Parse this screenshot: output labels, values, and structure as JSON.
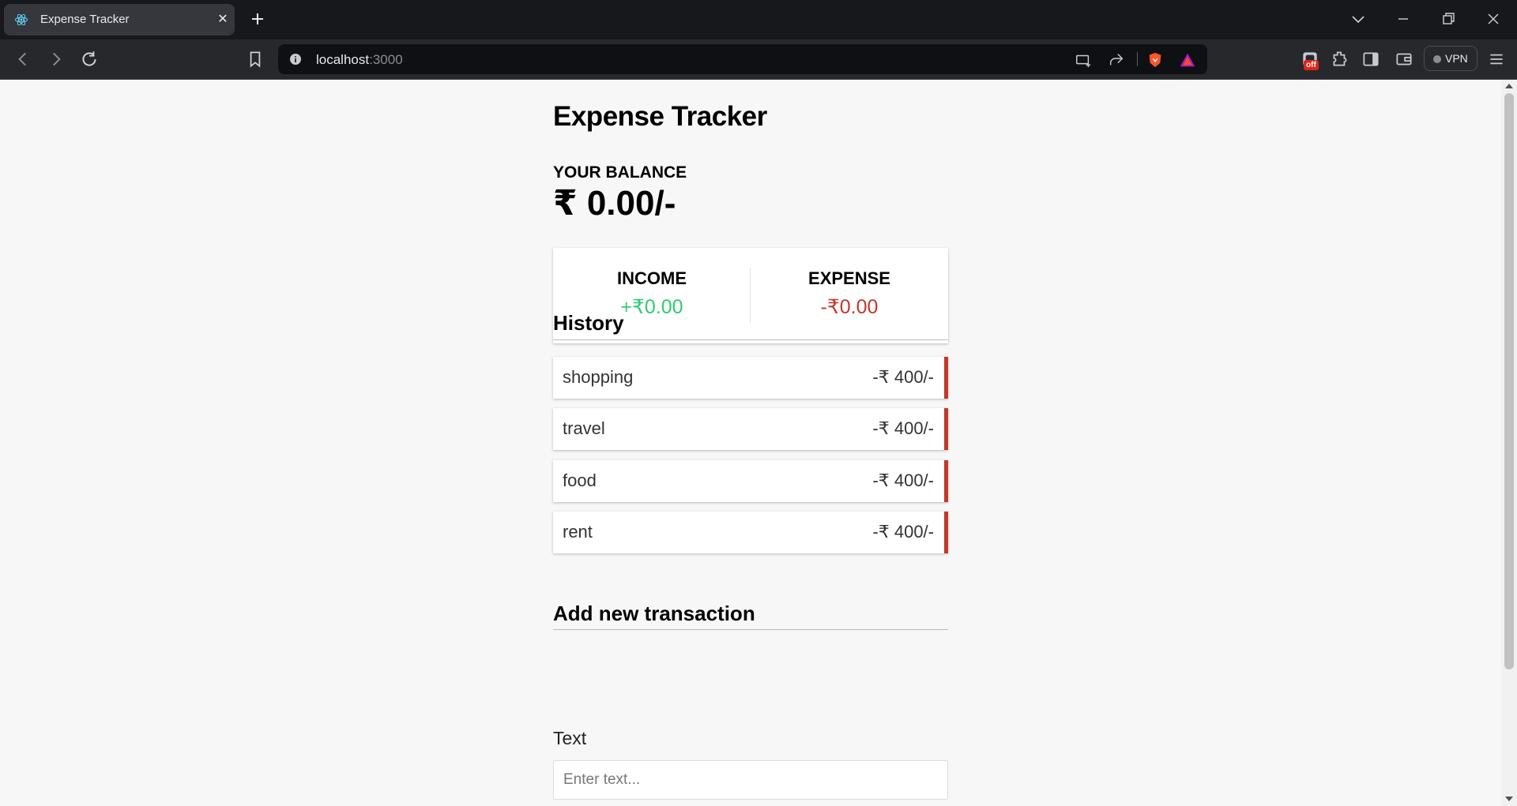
{
  "browser": {
    "tab_title": "Expense Tracker",
    "url_host": "localhost",
    "url_port": ":3000",
    "vpn_label": "VPN",
    "badge_off": "off"
  },
  "app": {
    "title": "Expense Tracker",
    "balance_label": "YOUR BALANCE",
    "balance_value": "₹ 0.00/-",
    "income_label": "INCOME",
    "income_value": "+₹0.00",
    "expense_label": "EXPENSE",
    "expense_value": "-₹0.00",
    "history_title": "History",
    "transactions": [
      {
        "text": "shopping",
        "amount": "-₹ 400/-"
      },
      {
        "text": "travel",
        "amount": "-₹ 400/-"
      },
      {
        "text": "food",
        "amount": "-₹ 400/-"
      },
      {
        "text": "rent",
        "amount": "-₹ 400/-"
      }
    ],
    "add_title": "Add new transaction",
    "text_label": "Text",
    "text_placeholder": "Enter text..."
  },
  "colors": {
    "income": "#2ecc71",
    "expense": "#c0392b"
  }
}
